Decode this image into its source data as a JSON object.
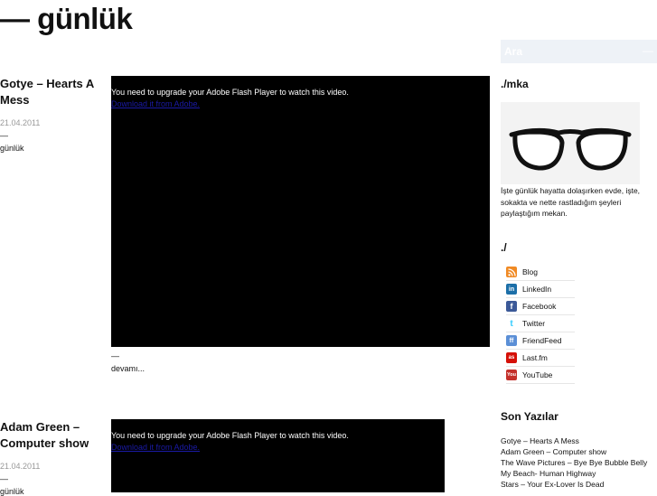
{
  "site": {
    "title": "— günlük"
  },
  "posts": [
    {
      "title": "Gotye – Hearts A Mess",
      "date": "21.04.2011",
      "dash": "—",
      "category": "günlük",
      "video_message": "You need to upgrade your Adobe Flash Player to watch this video.",
      "video_link": "Download it from Adobe.",
      "below_dash": "—",
      "more": "devamı..."
    },
    {
      "title": "Adam Green – Computer show",
      "date": "21.04.2011",
      "dash": "—",
      "category": "günlük",
      "video_message": "You need to upgrade your Adobe Flash Player to watch this video.",
      "video_link": "Download it from Adobe."
    }
  ],
  "sidebar": {
    "search_label": "Ara",
    "search_dash": "—",
    "about_heading": "./mka",
    "about_text": "İşte günlük hayatta dolaşırken evde, işte, sokakta ve nette rastladığım şeyleri paylaştığım mekan.",
    "links_heading": "./",
    "links": [
      {
        "label": "Blog",
        "icon": "rss-icon",
        "color": "#f08a24"
      },
      {
        "label": "LinkedIn",
        "icon": "linkedin-icon",
        "color": "#1c6fa8"
      },
      {
        "label": "Facebook",
        "icon": "facebook-icon",
        "color": "#3b5998"
      },
      {
        "label": "Twitter",
        "icon": "twitter-icon",
        "color": "#33ccff"
      },
      {
        "label": "FriendFeed",
        "icon": "friendfeed-icon",
        "color": "#5b8fd6"
      },
      {
        "label": "Last.fm",
        "icon": "lastfm-icon",
        "color": "#d51007"
      },
      {
        "label": "YouTube",
        "icon": "youtube-icon",
        "color": "#c4302b"
      }
    ],
    "recent_heading": "Son Yazılar",
    "recent_posts": [
      "Gotye – Hearts A Mess",
      "Adam Green – Computer show",
      "The Wave Pictures – Bye Bye Bubble Belly",
      "My Beach- Human Highway",
      "Stars – Your Ex-Lover Is Dead"
    ]
  }
}
